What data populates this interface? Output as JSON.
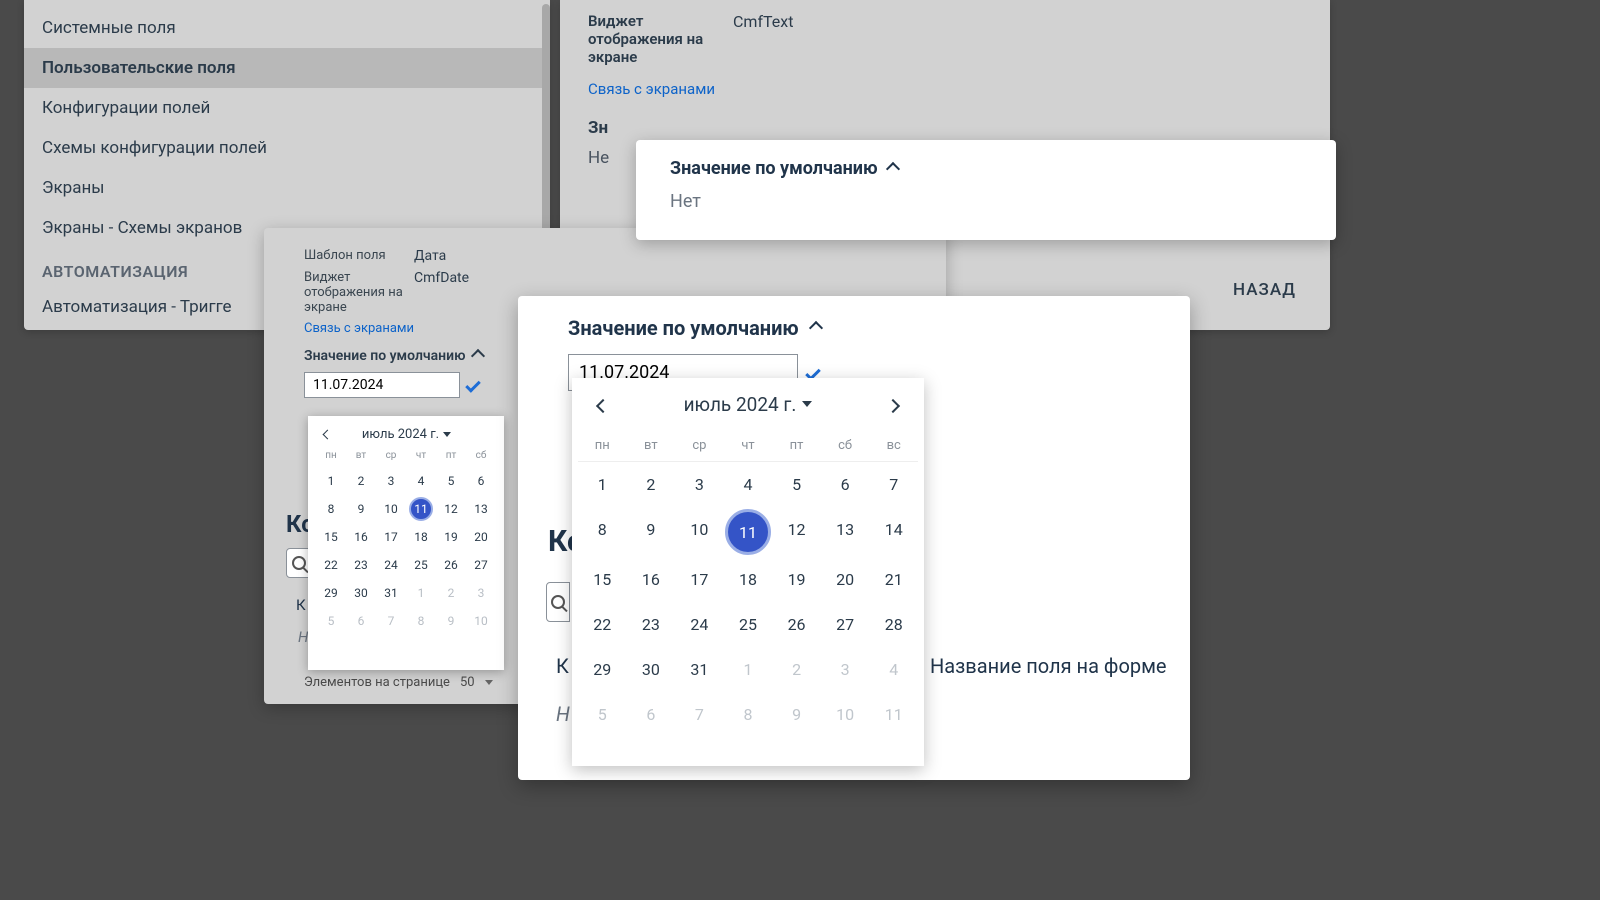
{
  "sidebar": {
    "items": [
      {
        "label": "Системные поля"
      },
      {
        "label": "Пользовательские поля"
      },
      {
        "label": "Конфигурации полей"
      },
      {
        "label": "Схемы конфигурации полей"
      },
      {
        "label": "Экраны"
      },
      {
        "label": "Экраны - Схемы экранов"
      }
    ],
    "section": "АВТОМАТИЗАЦИЯ",
    "last": "Автоматизация - Тригге"
  },
  "info": {
    "widgetLabel": "Виджет отображения на экране",
    "widgetValue": "CmfText",
    "link": "Связь с экранами",
    "defaultTitle": "Зн",
    "defaultValue": "Не",
    "back": "НАЗАД"
  },
  "popup": {
    "title": "Значение по умолчанию",
    "value": "Нет"
  },
  "mid": {
    "tplLabel": "Шаблон поля",
    "tplValue": "Дата",
    "widgetLabel": "Виджет отображения на экране",
    "widgetValue": "CmfDate",
    "link": "Связь с экранами",
    "section": "Значение по умолчанию",
    "dateValue": "11.07.2024",
    "footLabel": "Элементов на странице",
    "footValue": "50",
    "k": "Кс",
    "k2": "К",
    "h": "Н"
  },
  "big": {
    "title": "Значение по умолчанию",
    "dateValue": "11.07.2024",
    "k": "Кс",
    "k2": "К",
    "h": "Н",
    "colRight": "Название поля на форме"
  },
  "calendar": {
    "title": "июль 2024 г.",
    "dow": [
      "пн",
      "вт",
      "ср",
      "чт",
      "пт",
      "сб",
      "вс"
    ],
    "weeks": [
      [
        {
          "d": 1
        },
        {
          "d": 2
        },
        {
          "d": 3
        },
        {
          "d": 4
        },
        {
          "d": 5
        },
        {
          "d": 6
        },
        {
          "d": 7
        }
      ],
      [
        {
          "d": 8
        },
        {
          "d": 9
        },
        {
          "d": 10
        },
        {
          "d": 11,
          "sel": true
        },
        {
          "d": 12
        },
        {
          "d": 13
        },
        {
          "d": 14
        }
      ],
      [
        {
          "d": 15
        },
        {
          "d": 16
        },
        {
          "d": 17
        },
        {
          "d": 18
        },
        {
          "d": 19
        },
        {
          "d": 20
        },
        {
          "d": 21
        }
      ],
      [
        {
          "d": 22
        },
        {
          "d": 23
        },
        {
          "d": 24
        },
        {
          "d": 25
        },
        {
          "d": 26
        },
        {
          "d": 27
        },
        {
          "d": 28
        }
      ],
      [
        {
          "d": 29
        },
        {
          "d": 30
        },
        {
          "d": 31
        },
        {
          "d": 1,
          "m": true
        },
        {
          "d": 2,
          "m": true
        },
        {
          "d": 3,
          "m": true
        },
        {
          "d": 4,
          "m": true
        }
      ],
      [
        {
          "d": 5,
          "m": true
        },
        {
          "d": 6,
          "m": true
        },
        {
          "d": 7,
          "m": true
        },
        {
          "d": 8,
          "m": true
        },
        {
          "d": 9,
          "m": true
        },
        {
          "d": 10,
          "m": true
        },
        {
          "d": 11,
          "m": true
        }
      ]
    ],
    "weeksSm": [
      [
        {
          "d": 1
        },
        {
          "d": 2
        },
        {
          "d": 3
        },
        {
          "d": 4
        },
        {
          "d": 5
        },
        {
          "d": 6
        }
      ],
      [
        {
          "d": 8
        },
        {
          "d": 9
        },
        {
          "d": 10
        },
        {
          "d": 11,
          "sel": true
        },
        {
          "d": 12
        },
        {
          "d": 13
        }
      ],
      [
        {
          "d": 15
        },
        {
          "d": 16
        },
        {
          "d": 17
        },
        {
          "d": 18
        },
        {
          "d": 19
        },
        {
          "d": 20
        }
      ],
      [
        {
          "d": 22
        },
        {
          "d": 23
        },
        {
          "d": 24
        },
        {
          "d": 25
        },
        {
          "d": 26
        },
        {
          "d": 27
        }
      ],
      [
        {
          "d": 29
        },
        {
          "d": 30
        },
        {
          "d": 31
        },
        {
          "d": 1,
          "m": true
        },
        {
          "d": 2,
          "m": true
        },
        {
          "d": 3,
          "m": true
        }
      ],
      [
        {
          "d": 5,
          "m": true
        },
        {
          "d": 6,
          "m": true
        },
        {
          "d": 7,
          "m": true
        },
        {
          "d": 8,
          "m": true
        },
        {
          "d": 9,
          "m": true
        },
        {
          "d": 10,
          "m": true
        }
      ]
    ],
    "dowSm": [
      "пн",
      "вт",
      "ср",
      "чт",
      "пт",
      "сб"
    ]
  }
}
